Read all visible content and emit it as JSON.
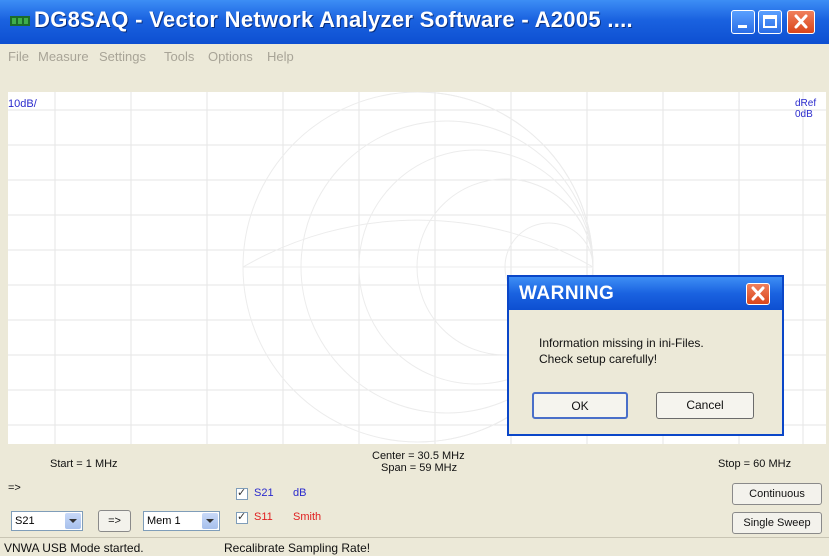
{
  "window": {
    "title": "DG8SAQ  - Vector Network Analyzer Software  - A2005 ...."
  },
  "menu": [
    "File",
    "Measure",
    "Settings",
    "Tools",
    "Options",
    "Help"
  ],
  "plot": {
    "scale_left": "10dB/",
    "scale_right_line1": "dRef",
    "scale_right_line2": "0dB",
    "start": "Start = 1 MHz",
    "center": "Center = 30.5 MHz",
    "span": "Span = 59 MHz",
    "stop": "Stop = 60 MHz"
  },
  "dialog": {
    "title": "WARNING",
    "line1": "Information missing in ini-Files.",
    "line2": "Check setup carefully!",
    "ok": "OK",
    "cancel": "Cancel"
  },
  "controls": {
    "arrow_label": "=>",
    "trace1": {
      "name": "S21",
      "mode": "dB",
      "color": "#2a2acd"
    },
    "trace2": {
      "name": "S11",
      "mode": "Smith",
      "color": "#e02020"
    },
    "param_select": "S21",
    "transfer_button": "=>",
    "mem_select": "Mem 1",
    "continuous": "Continuous",
    "single_sweep": "Single Sweep"
  },
  "status": {
    "mode": "VNWA USB Mode started.",
    "message": "Recalibrate Sampling Rate!"
  }
}
